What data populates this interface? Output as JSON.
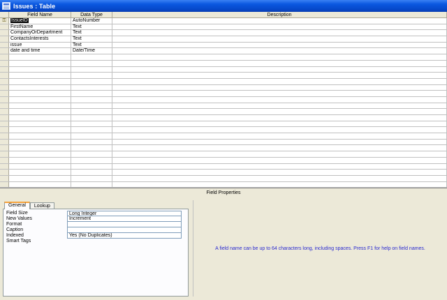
{
  "window": {
    "title": "Issues : Table",
    "icon": "table-icon"
  },
  "grid": {
    "columns": [
      "Field Name",
      "Data Type",
      "Description"
    ],
    "rows": [
      {
        "field_name": "IssueID",
        "data_type": "AutoNumber",
        "description": "",
        "primary_key": true
      },
      {
        "field_name": "FirstName",
        "data_type": "Text",
        "description": ""
      },
      {
        "field_name": "CompanyOrDepartment",
        "data_type": "Text",
        "description": ""
      },
      {
        "field_name": "ContactsInterests",
        "data_type": "Text",
        "description": ""
      },
      {
        "field_name": "issue",
        "data_type": "Text",
        "description": ""
      },
      {
        "field_name": "date and time",
        "data_type": "Date/Time",
        "description": ""
      }
    ],
    "empty_rows": 22
  },
  "field_properties": {
    "label": "Field Properties",
    "tabs": [
      "General",
      "Lookup"
    ],
    "active_tab": "General",
    "rows": [
      {
        "name": "Field Size",
        "value": "Long Integer"
      },
      {
        "name": "New Values",
        "value": "Increment"
      },
      {
        "name": "Format",
        "value": ""
      },
      {
        "name": "Caption",
        "value": ""
      },
      {
        "name": "Indexed",
        "value": "Yes (No Duplicates)"
      },
      {
        "name": "Smart Tags",
        "value": ""
      }
    ],
    "help_text": "A field name can be up to 64 characters long, including spaces.  Press F1 for help on field names."
  },
  "colors": {
    "titlebar": "#0a58e0",
    "help_text": "#2828d0",
    "tab_accent": "#f5a23a"
  }
}
